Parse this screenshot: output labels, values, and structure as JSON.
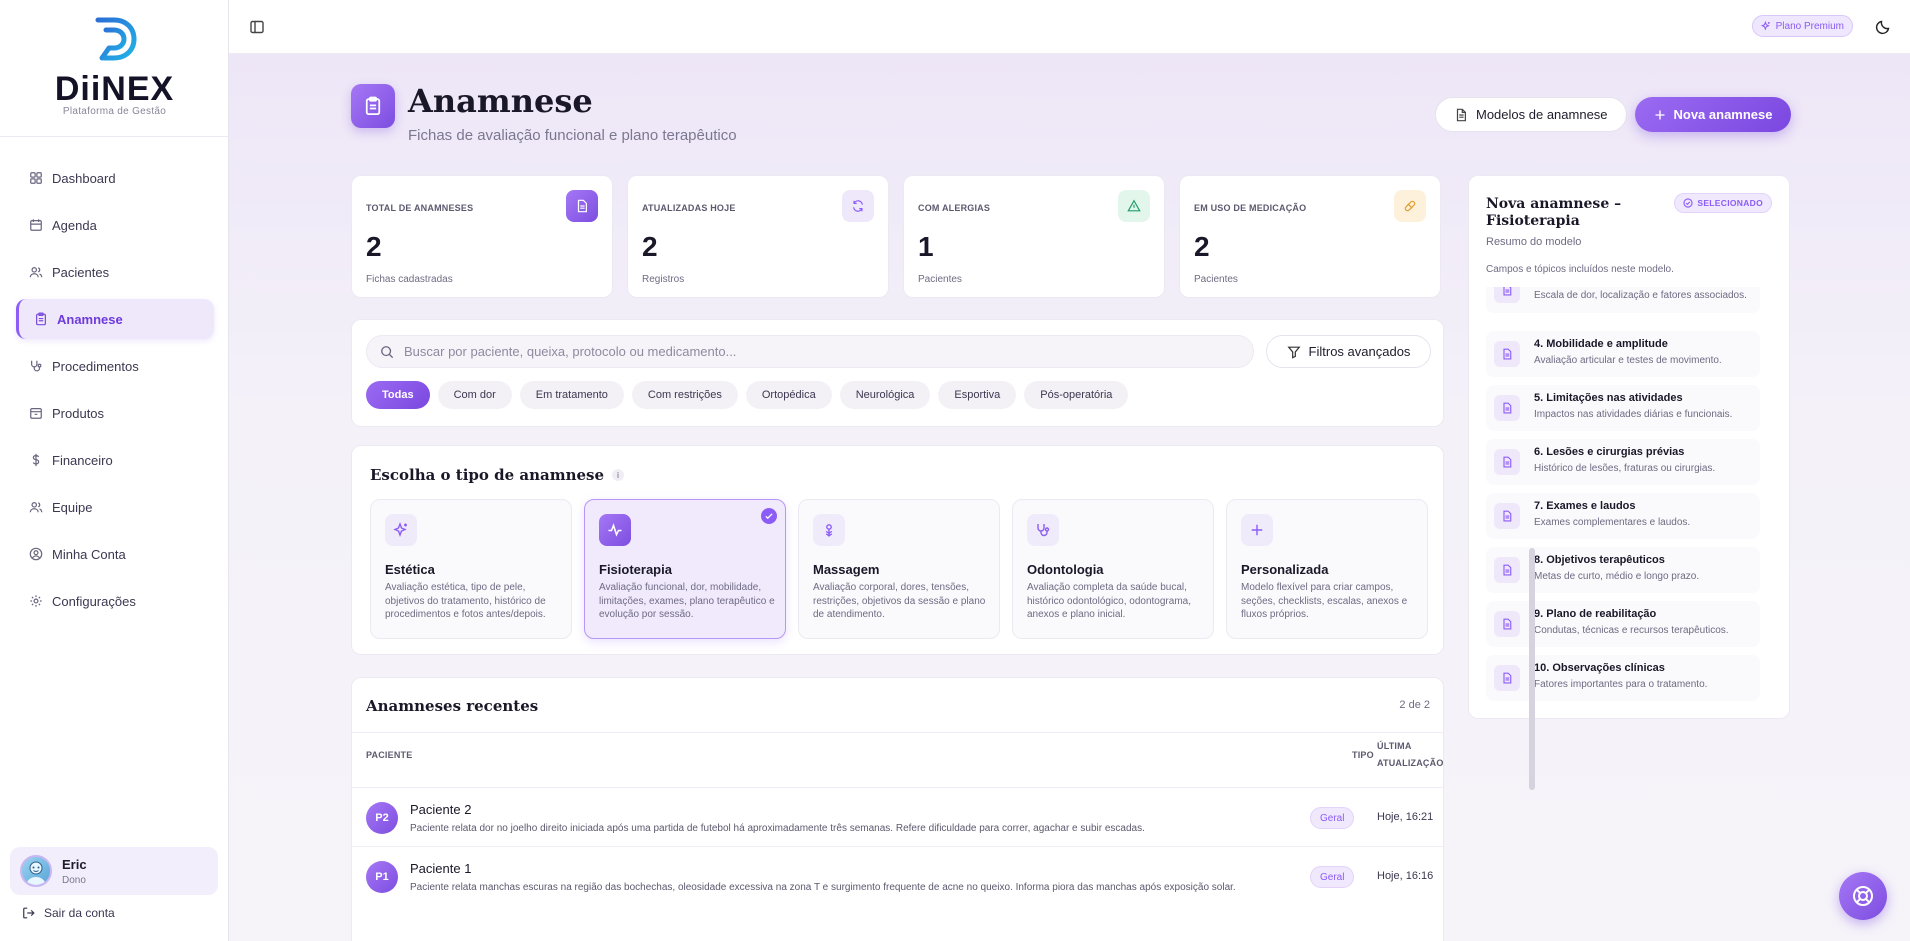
{
  "brand": {
    "name": "DiiNEX",
    "subtitle": "Plataforma de Gestão"
  },
  "sidebar": {
    "items": [
      {
        "label": "Dashboard",
        "icon": "dashboard-icon"
      },
      {
        "label": "Agenda",
        "icon": "calendar-icon"
      },
      {
        "label": "Pacientes",
        "icon": "users-icon"
      },
      {
        "label": "Anamnese",
        "icon": "clipboard-icon",
        "active": true
      },
      {
        "label": "Procedimentos",
        "icon": "stethoscope-icon"
      },
      {
        "label": "Produtos",
        "icon": "package-icon"
      },
      {
        "label": "Financeiro",
        "icon": "dollar-icon"
      },
      {
        "label": "Equipe",
        "icon": "team-icon"
      },
      {
        "label": "Minha Conta",
        "icon": "user-circle-icon"
      },
      {
        "label": "Configurações",
        "icon": "gear-icon"
      }
    ],
    "user": {
      "name": "Eric",
      "role": "Dono"
    },
    "logout_label": "Sair da conta"
  },
  "topbar": {
    "premium_label": "Plano Premium"
  },
  "header": {
    "title": "Anamnese",
    "subtitle": "Fichas de avaliação funcional e plano terapêutico",
    "models_button": "Modelos de anamnese",
    "new_button": "Nova anamnese"
  },
  "stats": [
    {
      "label": "TOTAL DE ANAMNESES",
      "value": "2",
      "sub": "Fichas cadastradas",
      "color": "#8b5cf6"
    },
    {
      "label": "ATUALIZADAS HOJE",
      "value": "2",
      "sub": "Registros",
      "color": "#8b5cf6"
    },
    {
      "label": "COM ALERGIAS",
      "value": "1",
      "sub": "Pacientes",
      "color": "#22a06b"
    },
    {
      "label": "EM USO DE MEDICAÇÃO",
      "value": "2",
      "sub": "Pacientes",
      "color": "#e0a030"
    }
  ],
  "search": {
    "placeholder": "Buscar por paciente, queixa, protocolo ou medicamento...",
    "filter_button": "Filtros avançados"
  },
  "filters": [
    "Todas",
    "Com dor",
    "Em tratamento",
    "Com restrições",
    "Ortopédica",
    "Neurológica",
    "Esportiva",
    "Pós-operatória"
  ],
  "types": {
    "title": "Escolha o tipo de anamnese",
    "info": "i",
    "items": [
      {
        "name": "Estética",
        "desc": "Avaliação estética, tipo de pele, objetivos do tratamento, histórico de procedimentos e fotos antes/depois.",
        "icon": "sparkles-icon"
      },
      {
        "name": "Fisioterapia",
        "desc": "Avaliação funcional, dor, mobilidade, limitações, exames, plano terapêutico e evolução por sessão.",
        "icon": "activity-icon",
        "selected": true
      },
      {
        "name": "Massagem",
        "desc": "Avaliação corporal, dores, tensões, restrições, objetivos da sessão e plano de atendimento.",
        "icon": "flower-icon"
      },
      {
        "name": "Odontologia",
        "desc": "Avaliação completa da saúde bucal, histórico odontológico, odontograma, anexos e plano inicial.",
        "icon": "stethoscope-icon"
      },
      {
        "name": "Personalizada",
        "desc": "Modelo flexível para criar campos, seções, checklists, escalas, anexos e fluxos próprios.",
        "icon": "plus-icon"
      }
    ]
  },
  "recent": {
    "title": "Anamneses recentes",
    "count": "2 de 2",
    "columns": {
      "patient": "PACIENTE",
      "type": "TIPO",
      "updated_1": "ÚLTIMA",
      "updated_2": "ATUALIZAÇÃO"
    },
    "rows": [
      {
        "initials": "P2",
        "name": "Paciente 2",
        "desc": "Paciente relata dor no joelho direito iniciada após uma partida de futebol há aproximadamente três semanas. Refere dificuldade para correr, agachar e subir escadas.",
        "type": "Geral",
        "updated": "Hoje, 16:21"
      },
      {
        "initials": "P1",
        "name": "Paciente 1",
        "desc": "Paciente relata manchas escuras na região das bochechas, oleosidade excessiva na zona T e surgimento frequente de acne no queixo. Informa piora das manchas após exposição solar.",
        "type": "Geral",
        "updated": "Hoje, 16:16"
      }
    ]
  },
  "summary": {
    "title": "Nova anamnese – Fisioterapia",
    "subtitle": "Resumo do modelo",
    "badge": "SELECIONADO",
    "note": "Campos e tópicos incluídos neste modelo.",
    "topics": [
      {
        "title": "",
        "desc": "Escala de dor, localização e fatores associados."
      },
      {
        "title": "4. Mobilidade e amplitude",
        "desc": "Avaliação articular e testes de movimento."
      },
      {
        "title": "5. Limitações nas atividades",
        "desc": "Impactos nas atividades diárias e funcionais."
      },
      {
        "title": "6. Lesões e cirurgias prévias",
        "desc": "Histórico de lesões, fraturas ou cirurgias."
      },
      {
        "title": "7. Exames e laudos",
        "desc": "Exames complementares e laudos."
      },
      {
        "title": "8. Objetivos terapêuticos",
        "desc": "Metas de curto, médio e longo prazo."
      },
      {
        "title": "9. Plano de reabilitação",
        "desc": "Condutas, técnicas e recursos terapêuticos."
      },
      {
        "title": "10. Observações clínicas",
        "desc": "Fatores importantes para o tratamento."
      }
    ]
  }
}
